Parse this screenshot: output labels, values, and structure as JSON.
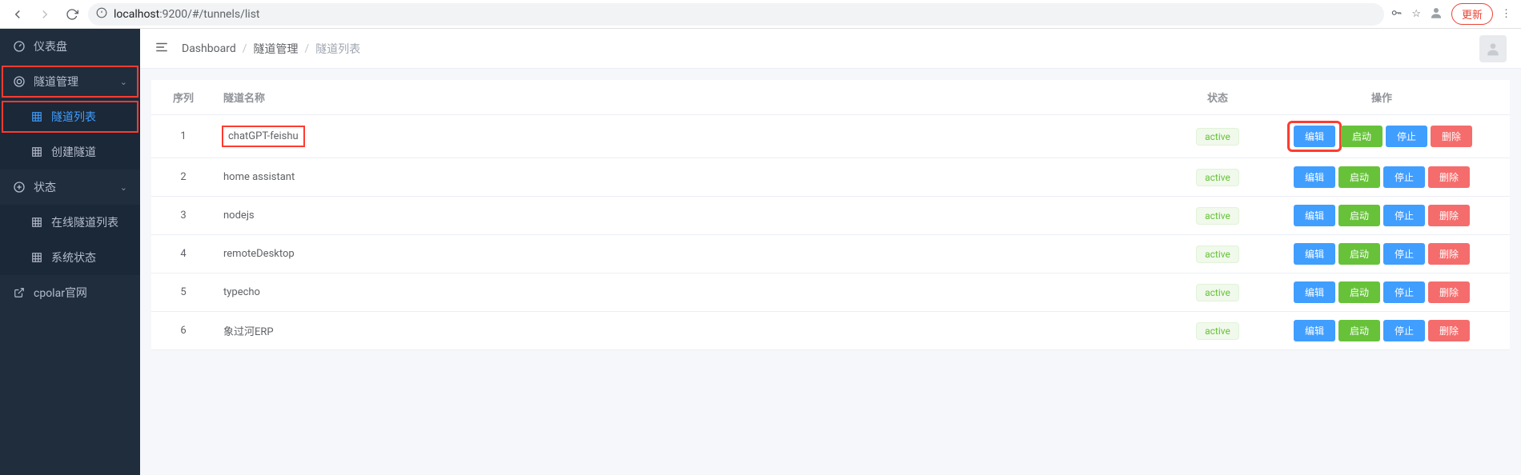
{
  "browser": {
    "url_host": "localhost",
    "url_port": ":9200",
    "url_path": "/#/tunnels/list",
    "update_label": "更新"
  },
  "sidebar": {
    "items": [
      {
        "icon": "dashboard",
        "label": "仪表盘",
        "expandable": false
      },
      {
        "icon": "tunnel",
        "label": "隧道管理",
        "expandable": true,
        "highlight": true,
        "children": [
          {
            "label": "隧道列表",
            "active": true,
            "highlight": true
          },
          {
            "label": "创建隧道",
            "active": false
          }
        ]
      },
      {
        "icon": "status",
        "label": "状态",
        "expandable": true,
        "children": [
          {
            "label": "在线隧道列表",
            "active": false
          },
          {
            "label": "系统状态",
            "active": false
          }
        ]
      },
      {
        "icon": "external",
        "label": "cpolar官网",
        "expandable": false
      }
    ]
  },
  "breadcrumb": {
    "items": [
      "Dashboard",
      "隧道管理",
      "隧道列表"
    ]
  },
  "table": {
    "headers": {
      "seq": "序列",
      "name": "隧道名称",
      "status": "状态",
      "actions": "操作"
    },
    "action_labels": {
      "edit": "编辑",
      "start": "启动",
      "stop": "停止",
      "delete": "删除"
    },
    "rows": [
      {
        "seq": "1",
        "name": "chatGPT-feishu",
        "status": "active",
        "name_highlight": true,
        "edit_highlight": true
      },
      {
        "seq": "2",
        "name": "home assistant",
        "status": "active"
      },
      {
        "seq": "3",
        "name": "nodejs",
        "status": "active"
      },
      {
        "seq": "4",
        "name": "remoteDesktop",
        "status": "active"
      },
      {
        "seq": "5",
        "name": "typecho",
        "status": "active"
      },
      {
        "seq": "6",
        "name": "象过河ERP",
        "status": "active"
      }
    ]
  }
}
